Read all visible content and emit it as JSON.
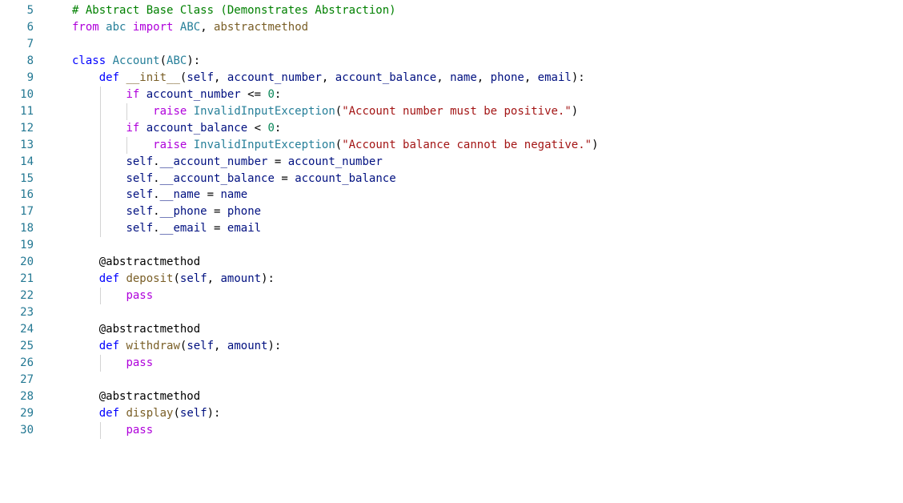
{
  "editor": {
    "colors": {
      "background": "#ffffff",
      "line_number": "#237893",
      "comment": "#008000",
      "keyword": "#0000ff",
      "control": "#af00db",
      "class": "#267f99",
      "function": "#795e26",
      "variable": "#001080",
      "string": "#a31515",
      "number": "#098658",
      "plain": "#000000",
      "indent_guide": "#d3d3d3"
    },
    "lines": [
      {
        "number": "5",
        "tokens": [
          {
            "t": "# Abstract Base Class (Demonstrates Abstraction)",
            "k": "comment"
          }
        ]
      },
      {
        "number": "6",
        "tokens": [
          {
            "t": "from",
            "k": "control"
          },
          {
            "t": " abc ",
            "k": "class"
          },
          {
            "t": "import",
            "k": "control"
          },
          {
            "t": " ",
            "k": "plain"
          },
          {
            "t": "ABC",
            "k": "class"
          },
          {
            "t": ", ",
            "k": "plain"
          },
          {
            "t": "abstractmethod",
            "k": "function"
          }
        ]
      },
      {
        "number": "7",
        "tokens": []
      },
      {
        "number": "8",
        "tokens": [
          {
            "t": "class",
            "k": "keyword"
          },
          {
            "t": " ",
            "k": "plain"
          },
          {
            "t": "Account",
            "k": "class"
          },
          {
            "t": "(",
            "k": "plain"
          },
          {
            "t": "ABC",
            "k": "class"
          },
          {
            "t": "):",
            "k": "plain"
          }
        ]
      },
      {
        "number": "9",
        "tokens": [
          {
            "t": "    ",
            "k": "plain"
          },
          {
            "t": "def",
            "k": "keyword"
          },
          {
            "t": " ",
            "k": "plain"
          },
          {
            "t": "__init__",
            "k": "function"
          },
          {
            "t": "(",
            "k": "plain"
          },
          {
            "t": "self",
            "k": "variable"
          },
          {
            "t": ", ",
            "k": "plain"
          },
          {
            "t": "account_number",
            "k": "variable"
          },
          {
            "t": ", ",
            "k": "plain"
          },
          {
            "t": "account_balance",
            "k": "variable"
          },
          {
            "t": ", ",
            "k": "plain"
          },
          {
            "t": "name",
            "k": "variable"
          },
          {
            "t": ", ",
            "k": "plain"
          },
          {
            "t": "phone",
            "k": "variable"
          },
          {
            "t": ", ",
            "k": "plain"
          },
          {
            "t": "email",
            "k": "variable"
          },
          {
            "t": "):",
            "k": "plain"
          }
        ]
      },
      {
        "number": "10",
        "tokens": [
          {
            "t": "        ",
            "k": "plain"
          },
          {
            "t": "if",
            "k": "control"
          },
          {
            "t": " ",
            "k": "plain"
          },
          {
            "t": "account_number",
            "k": "variable"
          },
          {
            "t": " <= ",
            "k": "plain"
          },
          {
            "t": "0",
            "k": "number"
          },
          {
            "t": ":",
            "k": "plain"
          }
        ]
      },
      {
        "number": "11",
        "tokens": [
          {
            "t": "            ",
            "k": "plain"
          },
          {
            "t": "raise",
            "k": "control"
          },
          {
            "t": " ",
            "k": "plain"
          },
          {
            "t": "InvalidInputException",
            "k": "class"
          },
          {
            "t": "(",
            "k": "plain"
          },
          {
            "t": "\"Account number must be positive.\"",
            "k": "string"
          },
          {
            "t": ")",
            "k": "plain"
          }
        ]
      },
      {
        "number": "12",
        "tokens": [
          {
            "t": "        ",
            "k": "plain"
          },
          {
            "t": "if",
            "k": "control"
          },
          {
            "t": " ",
            "k": "plain"
          },
          {
            "t": "account_balance",
            "k": "variable"
          },
          {
            "t": " < ",
            "k": "plain"
          },
          {
            "t": "0",
            "k": "number"
          },
          {
            "t": ":",
            "k": "plain"
          }
        ]
      },
      {
        "number": "13",
        "tokens": [
          {
            "t": "            ",
            "k": "plain"
          },
          {
            "t": "raise",
            "k": "control"
          },
          {
            "t": " ",
            "k": "plain"
          },
          {
            "t": "InvalidInputException",
            "k": "class"
          },
          {
            "t": "(",
            "k": "plain"
          },
          {
            "t": "\"Account balance cannot be negative.\"",
            "k": "string"
          },
          {
            "t": ")",
            "k": "plain"
          }
        ]
      },
      {
        "number": "14",
        "tokens": [
          {
            "t": "        ",
            "k": "plain"
          },
          {
            "t": "self",
            "k": "variable"
          },
          {
            "t": ".",
            "k": "plain"
          },
          {
            "t": "__account_number",
            "k": "variable"
          },
          {
            "t": " = ",
            "k": "plain"
          },
          {
            "t": "account_number",
            "k": "variable"
          }
        ]
      },
      {
        "number": "15",
        "tokens": [
          {
            "t": "        ",
            "k": "plain"
          },
          {
            "t": "self",
            "k": "variable"
          },
          {
            "t": ".",
            "k": "plain"
          },
          {
            "t": "__account_balance",
            "k": "variable"
          },
          {
            "t": " = ",
            "k": "plain"
          },
          {
            "t": "account_balance",
            "k": "variable"
          }
        ]
      },
      {
        "number": "16",
        "tokens": [
          {
            "t": "        ",
            "k": "plain"
          },
          {
            "t": "self",
            "k": "variable"
          },
          {
            "t": ".",
            "k": "plain"
          },
          {
            "t": "__name",
            "k": "variable"
          },
          {
            "t": " = ",
            "k": "plain"
          },
          {
            "t": "name",
            "k": "variable"
          }
        ]
      },
      {
        "number": "17",
        "tokens": [
          {
            "t": "        ",
            "k": "plain"
          },
          {
            "t": "self",
            "k": "variable"
          },
          {
            "t": ".",
            "k": "plain"
          },
          {
            "t": "__phone",
            "k": "variable"
          },
          {
            "t": " = ",
            "k": "plain"
          },
          {
            "t": "phone",
            "k": "variable"
          }
        ]
      },
      {
        "number": "18",
        "tokens": [
          {
            "t": "        ",
            "k": "plain"
          },
          {
            "t": "self",
            "k": "variable"
          },
          {
            "t": ".",
            "k": "plain"
          },
          {
            "t": "__email",
            "k": "variable"
          },
          {
            "t": " = ",
            "k": "plain"
          },
          {
            "t": "email",
            "k": "variable"
          }
        ]
      },
      {
        "number": "19",
        "tokens": []
      },
      {
        "number": "20",
        "tokens": [
          {
            "t": "    ",
            "k": "plain"
          },
          {
            "t": "@abstractmethod",
            "k": "decorator"
          }
        ]
      },
      {
        "number": "21",
        "tokens": [
          {
            "t": "    ",
            "k": "plain"
          },
          {
            "t": "def",
            "k": "keyword"
          },
          {
            "t": " ",
            "k": "plain"
          },
          {
            "t": "deposit",
            "k": "function"
          },
          {
            "t": "(",
            "k": "plain"
          },
          {
            "t": "self",
            "k": "variable"
          },
          {
            "t": ", ",
            "k": "plain"
          },
          {
            "t": "amount",
            "k": "variable"
          },
          {
            "t": "):",
            "k": "plain"
          }
        ]
      },
      {
        "number": "22",
        "tokens": [
          {
            "t": "        ",
            "k": "plain"
          },
          {
            "t": "pass",
            "k": "control"
          }
        ]
      },
      {
        "number": "23",
        "tokens": []
      },
      {
        "number": "24",
        "tokens": [
          {
            "t": "    ",
            "k": "plain"
          },
          {
            "t": "@abstractmethod",
            "k": "decorator"
          }
        ]
      },
      {
        "number": "25",
        "tokens": [
          {
            "t": "    ",
            "k": "plain"
          },
          {
            "t": "def",
            "k": "keyword"
          },
          {
            "t": " ",
            "k": "plain"
          },
          {
            "t": "withdraw",
            "k": "function"
          },
          {
            "t": "(",
            "k": "plain"
          },
          {
            "t": "self",
            "k": "variable"
          },
          {
            "t": ", ",
            "k": "plain"
          },
          {
            "t": "amount",
            "k": "variable"
          },
          {
            "t": "):",
            "k": "plain"
          }
        ]
      },
      {
        "number": "26",
        "tokens": [
          {
            "t": "        ",
            "k": "plain"
          },
          {
            "t": "pass",
            "k": "control"
          }
        ]
      },
      {
        "number": "27",
        "tokens": []
      },
      {
        "number": "28",
        "tokens": [
          {
            "t": "    ",
            "k": "plain"
          },
          {
            "t": "@abstractmethod",
            "k": "decorator"
          }
        ]
      },
      {
        "number": "29",
        "tokens": [
          {
            "t": "    ",
            "k": "plain"
          },
          {
            "t": "def",
            "k": "keyword"
          },
          {
            "t": " ",
            "k": "plain"
          },
          {
            "t": "display",
            "k": "function"
          },
          {
            "t": "(",
            "k": "plain"
          },
          {
            "t": "self",
            "k": "variable"
          },
          {
            "t": "):",
            "k": "plain"
          }
        ]
      },
      {
        "number": "30",
        "tokens": [
          {
            "t": "        ",
            "k": "plain"
          },
          {
            "t": "pass",
            "k": "control"
          }
        ]
      }
    ]
  }
}
